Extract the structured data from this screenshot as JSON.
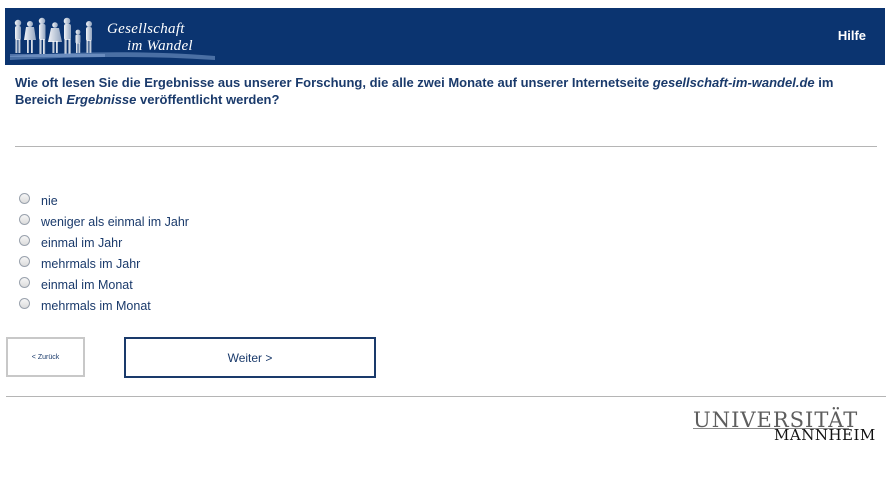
{
  "header": {
    "logo_line1": "Gesellschaft",
    "logo_line2": "im Wandel",
    "help_label": "Hilfe"
  },
  "question": {
    "part1": "Wie oft lesen Sie die Ergebnisse aus unserer Forschung, die alle zwei Monate auf unserer Internetseite ",
    "site": "gesellschaft-im-wandel.de",
    "part2": " im Bereich ",
    "section": "Ergebnisse",
    "part3": " veröffentlicht werden?"
  },
  "options": [
    {
      "label": "nie"
    },
    {
      "label": "weniger als einmal im Jahr"
    },
    {
      "label": "einmal im Jahr"
    },
    {
      "label": "mehrmals im Jahr"
    },
    {
      "label": "einmal im Monat"
    },
    {
      "label": "mehrmals im Monat"
    }
  ],
  "nav": {
    "back_label": "< Zurück",
    "next_label": "Weiter >"
  },
  "footer": {
    "uni_line1": "UNIVERSITÄT",
    "uni_line2": "MANNHEIM"
  },
  "colors": {
    "header_bg": "#0b3470",
    "text": "#1a3a6b"
  }
}
